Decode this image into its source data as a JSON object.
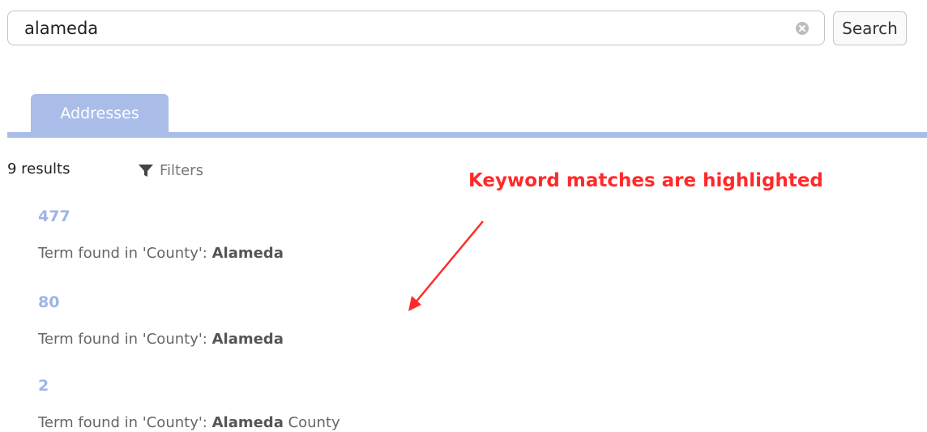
{
  "search": {
    "value": "alameda",
    "button_label": "Search"
  },
  "tabs": [
    {
      "label": "Addresses",
      "active": true
    }
  ],
  "results_meta": {
    "count_label": "9 results",
    "filters_label": "Filters"
  },
  "annotation": {
    "text": "Keyword matches are highlighted",
    "color": "#ff2a2a"
  },
  "results": [
    {
      "id": "477",
      "prefix": "Term found in 'County': ",
      "match": "Alameda",
      "suffix": ""
    },
    {
      "id": "80",
      "prefix": "Term found in 'County': ",
      "match": "Alameda",
      "suffix": ""
    },
    {
      "id": "2",
      "prefix": "Term found in 'County': ",
      "match": "Alameda",
      "suffix": " County"
    }
  ],
  "colors": {
    "accent": "#a9bde8",
    "link": "#9eb5e6"
  },
  "icons": {
    "clear": "clear-circle-x-icon",
    "filter": "funnel-icon"
  }
}
